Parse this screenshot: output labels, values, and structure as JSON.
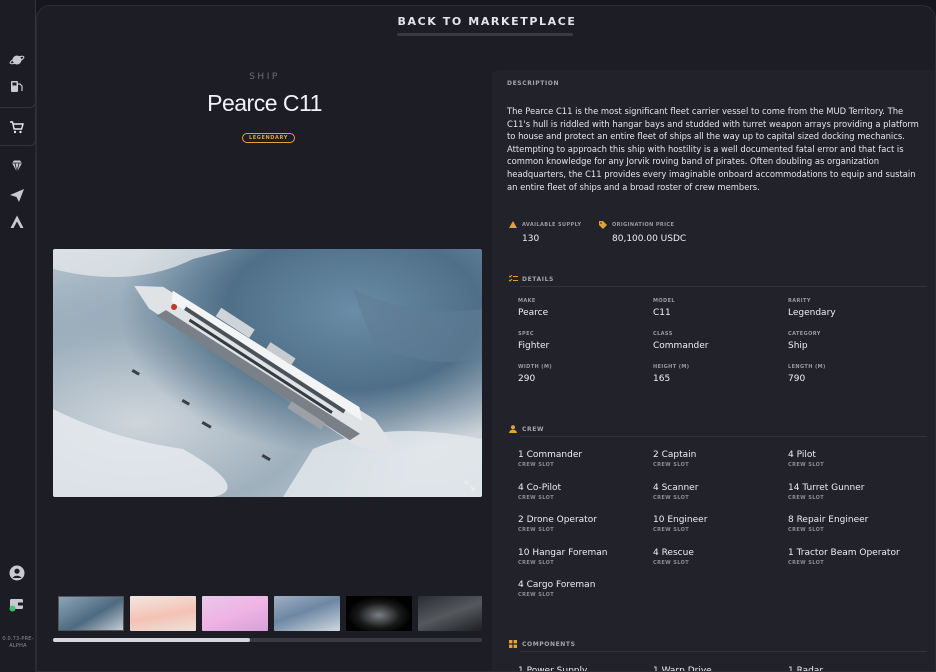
{
  "rail": {
    "version": "0.0.73-PRE-ALPHA",
    "icons": [
      "planet-icon",
      "gas-pump-icon",
      "cart-icon",
      "diamond-icon",
      "paper-plane-icon",
      "star-atlas-logo-icon",
      "user-icon",
      "wallet-icon"
    ]
  },
  "header": {
    "back_label": "BACK TO MARKETPLACE"
  },
  "item": {
    "category": "SHIP",
    "name": "Pearce C11",
    "rarity_badge": "LEGENDARY"
  },
  "colors": {
    "accent": "#e0a23a",
    "background": "#1d1d26",
    "panel": "#22222b"
  },
  "description": {
    "heading": "DESCRIPTION",
    "text": "The Pearce C11 is the most significant fleet carrier vessel to come from the MUD Territory. The C11's hull is riddled with hangar bays and studded with turret weapon arrays providing a platform to house and protect an entire fleet of ships all the way up to capital sized docking mechanics. Attempting to approach this ship with hostility is a well documented fatal error and that fact is common knowledge for any Jorvik roving band of pirates. Often doubling as organization headquarters, the C11 provides every imaginable onboard accommodations to equip and sustain an entire fleet of ships and a broad roster of crew members."
  },
  "stats": {
    "supply_label": "AVAILABLE SUPPLY",
    "supply_value": "130",
    "price_label": "ORIGINATION PRICE",
    "price_value": "80,100.00 USDC"
  },
  "details": {
    "heading": "DETAILS",
    "fields": [
      {
        "k": "MAKE",
        "v": "Pearce"
      },
      {
        "k": "MODEL",
        "v": "C11"
      },
      {
        "k": "RARITY",
        "v": "Legendary"
      },
      {
        "k": "SPEC",
        "v": "Fighter"
      },
      {
        "k": "CLASS",
        "v": "Commander"
      },
      {
        "k": "CATEGORY",
        "v": "Ship"
      },
      {
        "k": "WIDTH (M)",
        "v": "290"
      },
      {
        "k": "HEIGHT (M)",
        "v": "165"
      },
      {
        "k": "LENGTH (M)",
        "v": "790"
      }
    ]
  },
  "crew": {
    "heading": "CREW",
    "slot_label": "CREW SLOT",
    "items": [
      "1 Commander",
      "2 Captain",
      "4 Pilot",
      "4 Co-Pilot",
      "4 Scanner",
      "14 Turret Gunner",
      "2 Drone Operator",
      "10 Engineer",
      "8 Repair Engineer",
      "10 Hangar Foreman",
      "4 Rescue",
      "1 Tractor Beam Operator",
      "4 Cargo Foreman"
    ]
  },
  "components": {
    "heading": "COMPONENTS",
    "items": [
      "1 Power Supply",
      "1 Warp Drive",
      "1 Radar"
    ]
  },
  "gallery": {
    "thumbnail_count": 6,
    "scroll_position": 0.46
  }
}
